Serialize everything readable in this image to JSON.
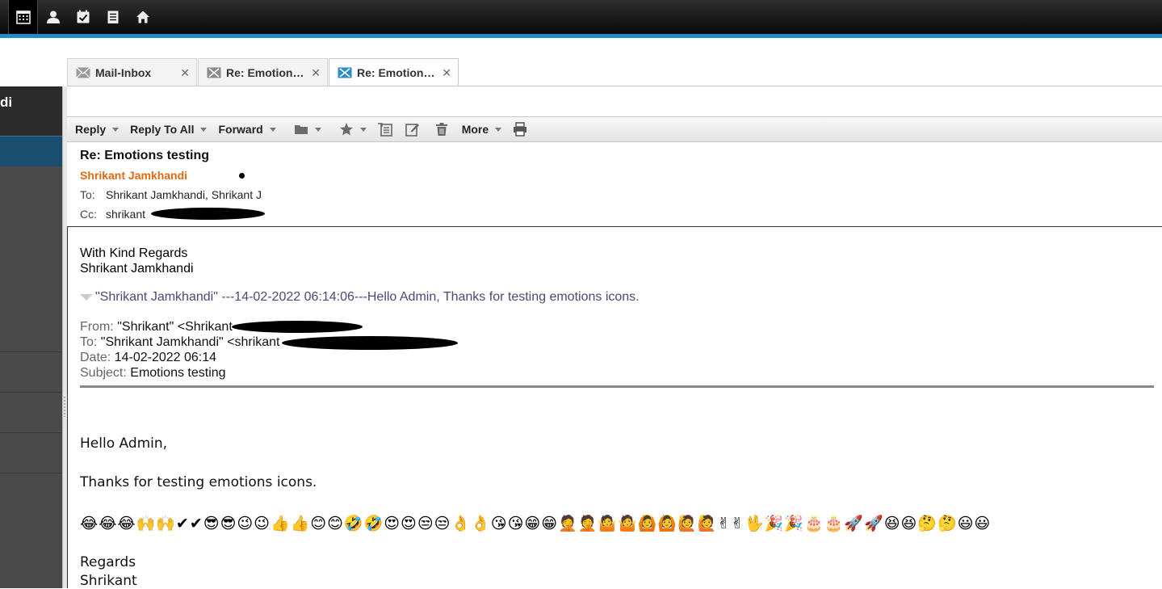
{
  "topbar": {
    "icons": [
      "calendar-icon",
      "contact-icon",
      "task-icon",
      "notes-icon",
      "home-icon"
    ]
  },
  "leftpanel": {
    "title": "di"
  },
  "tabs": [
    {
      "label": "Mail-Inbox",
      "close": "✕"
    },
    {
      "label": "Re: Emotions testing",
      "close": "✕"
    },
    {
      "label": "Re: Emotions testing",
      "close": "✕"
    }
  ],
  "toolbar": {
    "reply": "Reply",
    "reply_all": "Reply To All",
    "forward": "Forward",
    "more": "More"
  },
  "mail": {
    "subject": "Re: Emotions testing",
    "sender": "Shrikant Jamkhandi",
    "to_label": "To:",
    "to_value": "Shrikant Jamkhandi, Shrikant J",
    "cc_label": "Cc:",
    "cc_value": "shrikant"
  },
  "body": {
    "sig_line1": "With Kind Regards",
    "sig_line2": "Shrikant Jamkhandi",
    "quote_header": "\"Shrikant Jamkhandi\" ---14-02-2022 06:14:06---Hello Admin, Thanks for testing emotions icons.",
    "from_label": "From:",
    "from_value": "\"Shrikant\" <Shrikant",
    "to_label": "To:",
    "to_value": "\"Shrikant Jamkhandi\" <shrikant",
    "date_label": "Date:",
    "date_value": "14-02-2022 06:14",
    "subject_label": "Subject:",
    "subject_value": "Emotions testing",
    "greeting": "Hello Admin,",
    "thanks": "Thanks for testing emotions icons.",
    "emojis": "😂😂😂🙌🙌✔✔😎😎😉😉👍👍😊😊🤣🤣😍😍😒😒👌👌😘😘😁😁🤦🤦🤷🤷🙆🙆🙋🙋✌✌🖖🎉🎉🎂🎂🚀🚀😆😆🤔🤔😃😃",
    "regards": "Regards",
    "name": "Shrikant"
  }
}
